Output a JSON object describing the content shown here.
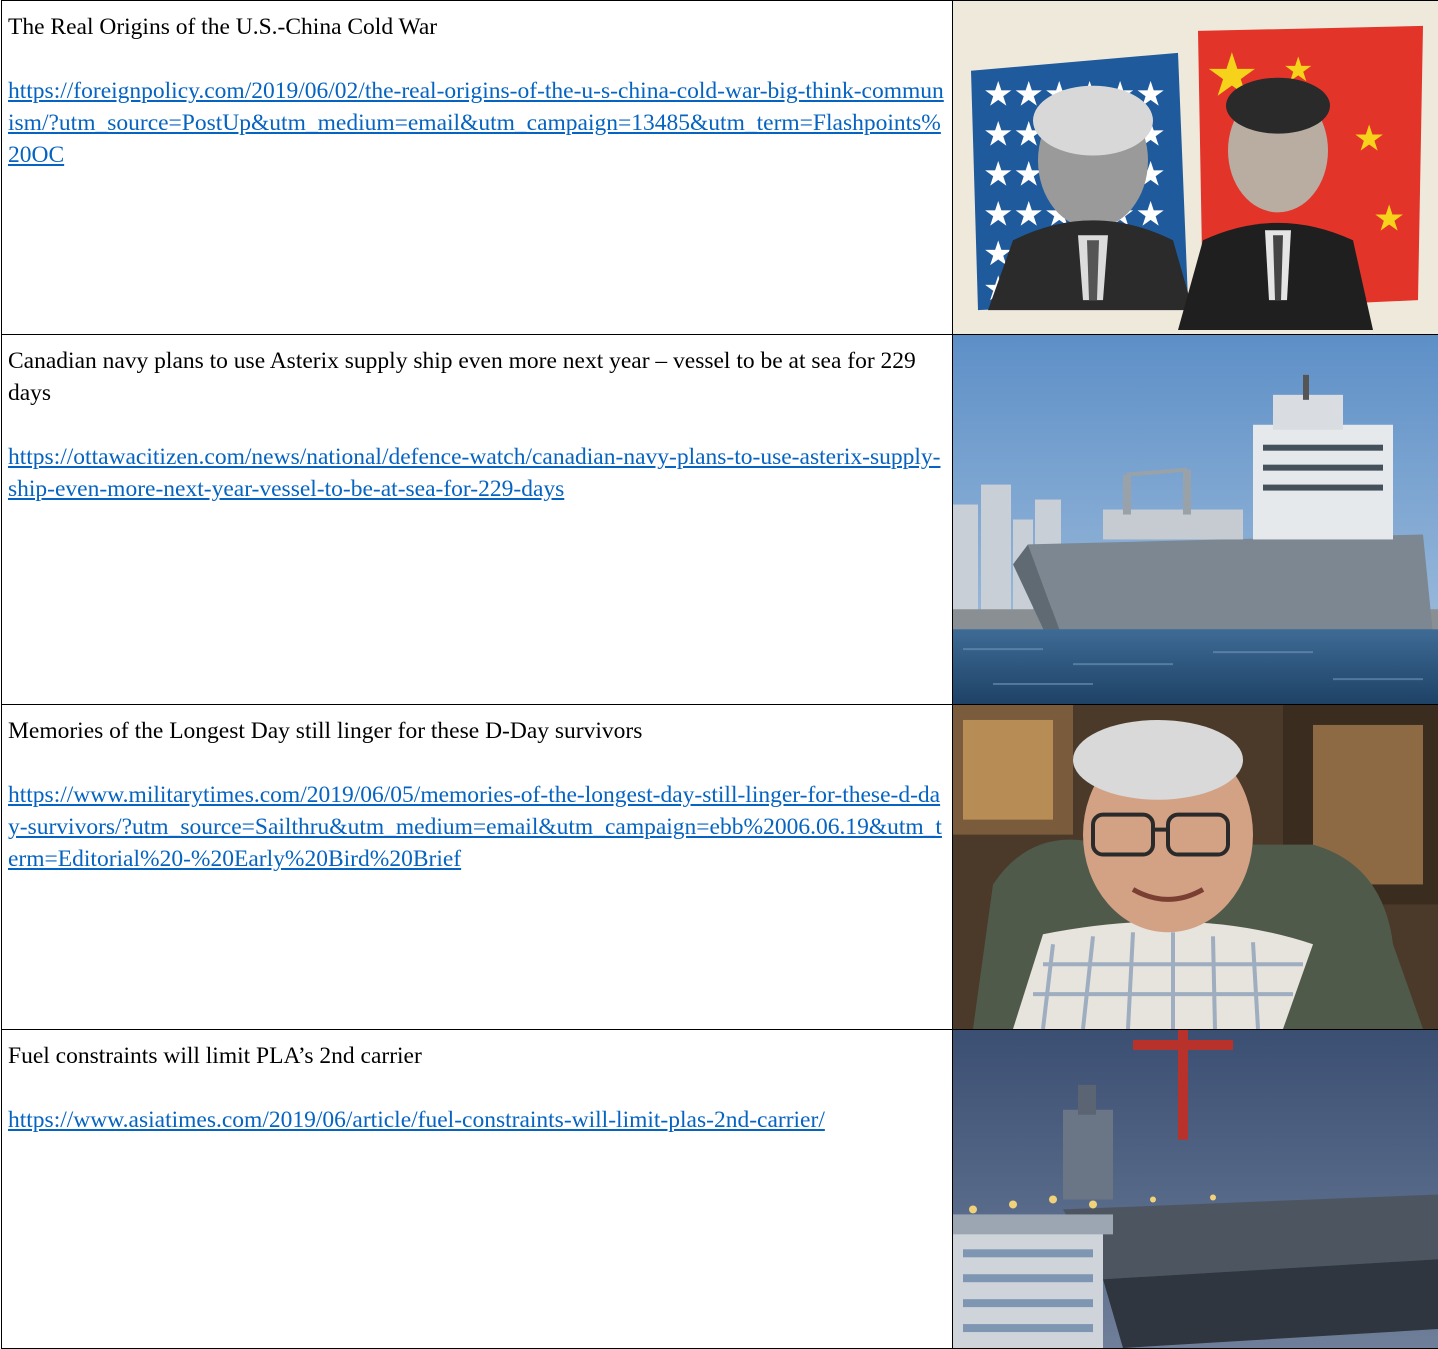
{
  "rows": [
    {
      "title": "The Real Origins of the U.S.-China Cold War",
      "url": "https://foreignpolicy.com/2019/06/02/the-real-origins-of-the-u-s-china-cold-war-big-think-communism/?utm_source=PostUp&utm_medium=email&utm_campaign=13485&utm_term=Flashpoints%20OC",
      "image": "us-china-leaders-collage"
    },
    {
      "title": "Canadian navy plans to use Asterix supply ship even more next year – vessel to be at sea for 229 days",
      "url": "https://ottawacitizen.com/news/national/defence-watch/canadian-navy-plans-to-use-asterix-supply-ship-even-more-next-year-vessel-to-be-at-sea-for-229-days",
      "image": "supply-ship-harbour-photo"
    },
    {
      "title": "Memories of the Longest Day still linger for these D-Day survivors",
      "url": "https://www.militarytimes.com/2019/06/05/memories-of-the-longest-day-still-linger-for-these-d-day-survivors/?utm_source=Sailthru&utm_medium=email&utm_campaign=ebb%2006.06.19&utm_term=Editorial%20-%20Early%20Bird%20Brief",
      "image": "veteran-portrait-photo"
    },
    {
      "title": "Fuel constraints will limit PLA’s 2nd carrier",
      "url": "https://www.asiatimes.com/2019/06/article/fuel-constraints-will-limit-plas-2nd-carrier/",
      "image": "aircraft-carrier-dock-photo"
    }
  ]
}
